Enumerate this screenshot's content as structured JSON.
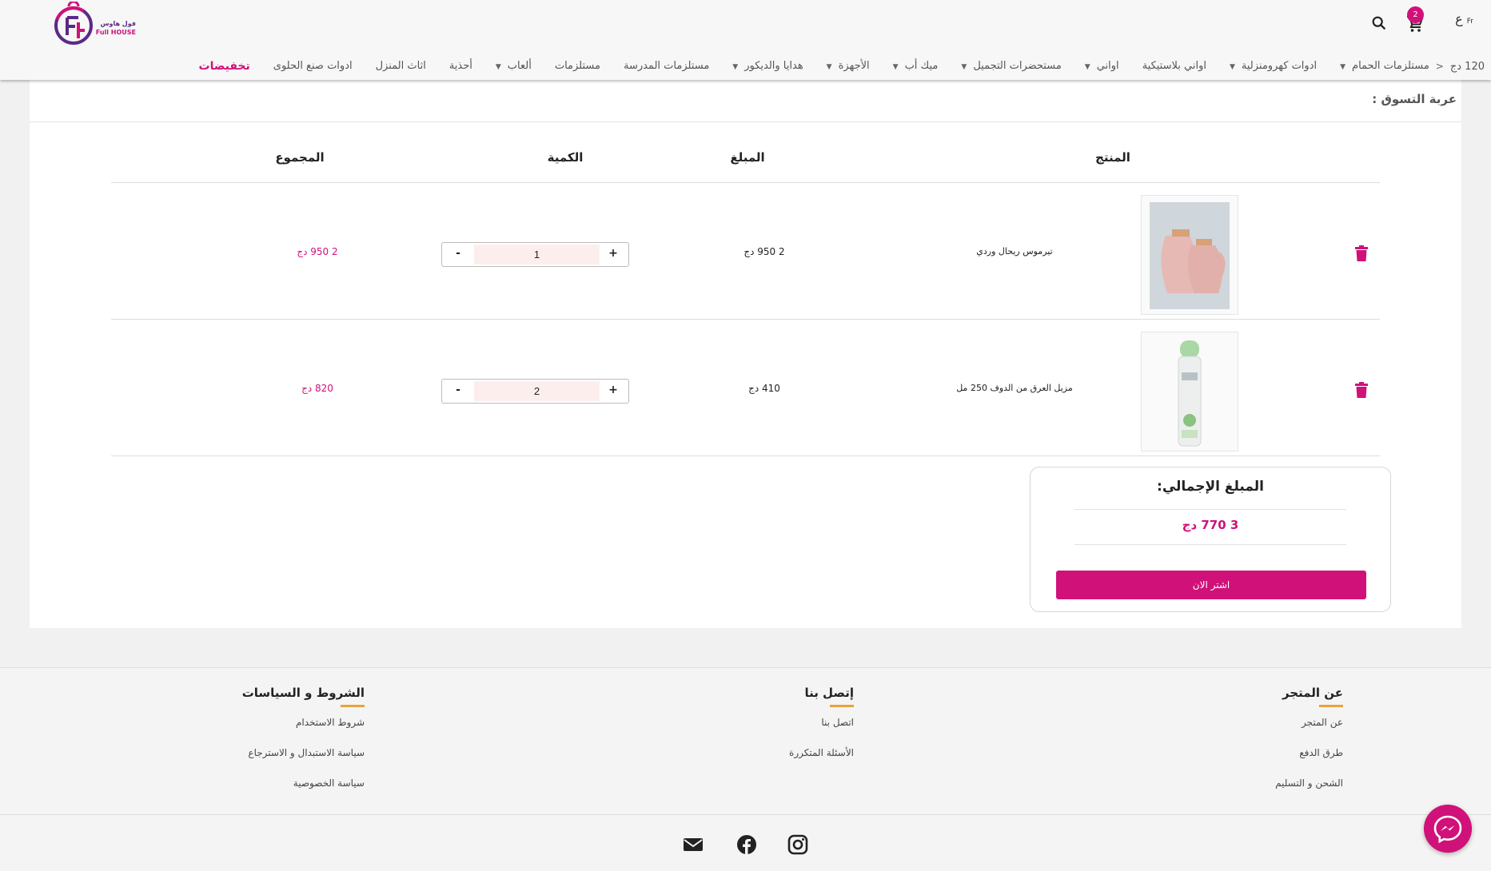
{
  "header": {
    "logo_ar": "فول هاوس",
    "logo_en": "Full HOUSE",
    "cart_count": "2",
    "lang_ar": "ع",
    "lang_fr": "Fr",
    "nav": [
      {
        "label": "120 دج",
        "caret": false,
        "arrow": true
      },
      {
        "label": "مستلزمات الحمام",
        "caret": true
      },
      {
        "label": "ادوات كهرومنزلية",
        "caret": true
      },
      {
        "label": "اواني بلاستيكية",
        "caret": false
      },
      {
        "label": "اواني",
        "caret": true
      },
      {
        "label": "مستحضرات التجميل",
        "caret": true
      },
      {
        "label": "ميك أب",
        "caret": true
      },
      {
        "label": "الأجهزة",
        "caret": true
      },
      {
        "label": "هدايا والديكور",
        "caret": true
      },
      {
        "label": "مستلزمات المدرسة",
        "caret": false
      },
      {
        "label": "مستلزمات",
        "caret": false
      },
      {
        "label": "ألعاب",
        "caret": true
      },
      {
        "label": "أحذية",
        "caret": false
      },
      {
        "label": "اثاث المنزل",
        "caret": false
      },
      {
        "label": "ادوات صنع الحلوى",
        "caret": false
      },
      {
        "label": "تخفيضات",
        "caret": false,
        "sale": true
      }
    ]
  },
  "cart": {
    "title": "عربة التسوق :",
    "columns": {
      "product": "المنتج",
      "price": "المبلغ",
      "quantity": "الكمية",
      "total": "المجموع"
    },
    "items": [
      {
        "name": "تيرموس ريحال وردي",
        "price": "2 950 دج",
        "qty": "1",
        "total": "2 950 دج"
      },
      {
        "name": "مزيل العرق من الدوف 250 مل",
        "price": "410 دج",
        "qty": "2",
        "total": "820 دج"
      }
    ],
    "minus": "-",
    "plus": "+",
    "summary": {
      "title": "المبلغ   الإجمالي:",
      "amount": "3 770 دج",
      "buy": "اشتر الان"
    }
  },
  "footer": {
    "store": {
      "title": "عن المتجر",
      "links": [
        "عن المتجر",
        "طرق الدفع",
        "الشحن و التسليم"
      ]
    },
    "contact": {
      "title": "إتصل بنا",
      "links": [
        "اتصل بنا",
        "الأسئلة المتكررة"
      ]
    },
    "policies": {
      "title": "الشروط و السياسات",
      "links": [
        "شروط الاستخدام",
        "سياسة الاستبدال و الاسترجاع",
        "سياسة الخصوصية"
      ]
    }
  },
  "colors": {
    "accent": "#d0117a",
    "underline": "#e8a23a",
    "logo_purple": "#5b2a86"
  }
}
